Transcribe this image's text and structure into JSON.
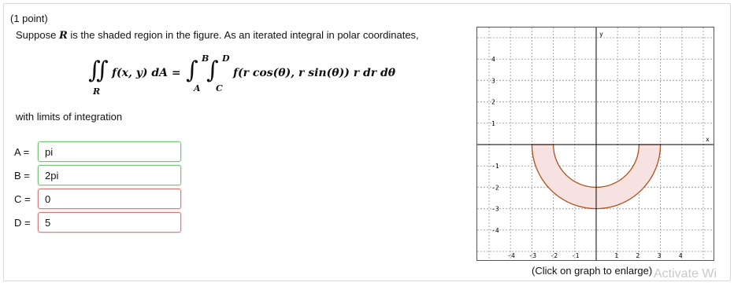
{
  "problem": {
    "points": "(1 point)",
    "intro": "Suppose",
    "region": "R",
    "rest": "is the shaded region in the figure. As an iterated integral in polar coordinates,",
    "limits_label": "with limits of integration"
  },
  "formula": {
    "integrand_left": "f(x, y) dA =",
    "region_sub": "R",
    "outer_lower": "A",
    "outer_upper": "B",
    "inner_lower": "C",
    "inner_upper": "D",
    "integrand_right": "f(r cos(θ), r sin(θ)) r dr dθ"
  },
  "answers": [
    {
      "label": "A =",
      "value": "pi",
      "status": "correct"
    },
    {
      "label": "B =",
      "value": "2pi",
      "status": "correct"
    },
    {
      "label": "C =",
      "value": "0",
      "status": "incorrect"
    },
    {
      "label": "D =",
      "value": "5",
      "status": "incorrect"
    }
  ],
  "graph": {
    "x_axis_label": "x",
    "y_axis_label": "y",
    "x_ticks": [
      "-4",
      "-3",
      "-2",
      "-1",
      "1",
      "2",
      "3",
      "4"
    ],
    "y_ticks": [
      "4",
      "3",
      "2",
      "1",
      "-1",
      "-2",
      "-3",
      "-4"
    ],
    "caption": "(Click on graph to enlarge)",
    "fill_color": "#f6e3e1",
    "stroke_color": "#b0501e"
  },
  "watermark": "Activate Wi"
}
